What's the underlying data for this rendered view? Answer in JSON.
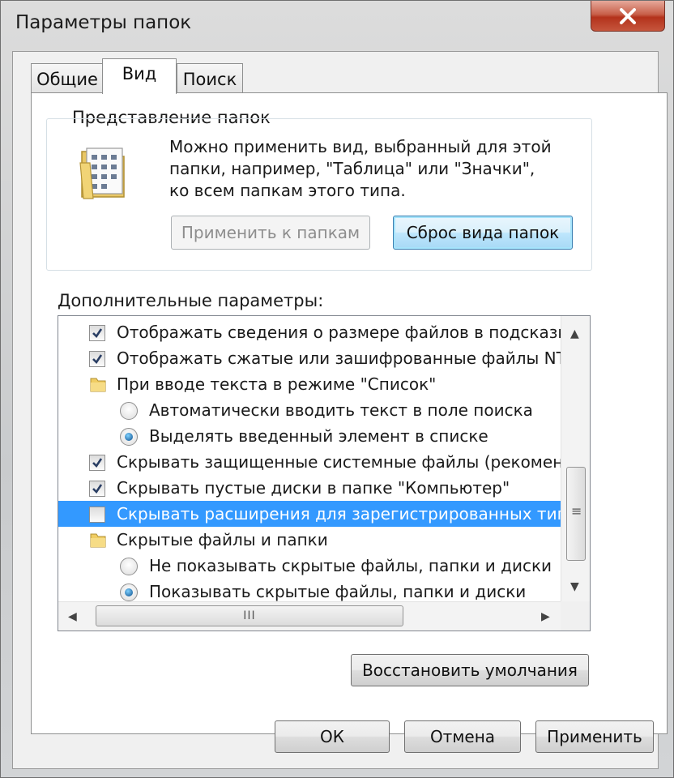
{
  "window": {
    "title": "Параметры папок"
  },
  "tabs": [
    {
      "label": "Общие"
    },
    {
      "label": "Вид"
    },
    {
      "label": "Поиск"
    }
  ],
  "folder_views": {
    "title": "Представление папок",
    "description": [
      "Можно применить вид, выбранный для этой",
      "папки, например, \"Таблица\" или \"Значки\",",
      "ко всем папкам этого типа."
    ],
    "apply_button": "Применить к папкам",
    "reset_button": "Сброс вида папок"
  },
  "advanced": {
    "label": "Дополнительные параметры:",
    "items": [
      {
        "type": "checkbox",
        "checked": true,
        "label": "Отображать сведения о размере файлов в подсказках"
      },
      {
        "type": "checkbox",
        "checked": true,
        "label": "Отображать сжатые или зашифрованные файлы NTFS"
      },
      {
        "type": "folder",
        "label": "При вводе текста в режиме \"Список\""
      },
      {
        "type": "radio",
        "checked": false,
        "label": "Автоматически вводить текст в поле поиска"
      },
      {
        "type": "radio",
        "checked": true,
        "label": "Выделять введенный элемент в списке"
      },
      {
        "type": "checkbox",
        "checked": true,
        "label": "Скрывать защищенные системные файлы (рекомендуется)"
      },
      {
        "type": "checkbox",
        "checked": true,
        "label": "Скрывать пустые диски в папке \"Компьютер\""
      },
      {
        "type": "checkbox",
        "checked": false,
        "selected": true,
        "label": "Скрывать расширения для зарегистрированных типов файлов"
      },
      {
        "type": "folder",
        "label": "Скрытые файлы и папки"
      },
      {
        "type": "radio",
        "checked": false,
        "label": "Не показывать скрытые файлы, папки и диски"
      },
      {
        "type": "radio",
        "checked": true,
        "label": "Показывать скрытые файлы, папки и диски"
      }
    ],
    "hscroll_grip": "III",
    "vscroll_grip": "≡"
  },
  "restore_button": "Восстановить умолчания",
  "footer": {
    "ok": "ОК",
    "cancel": "Отмена",
    "apply": "Применить"
  },
  "colors": {
    "selection": "#3399ff",
    "close_button": "#c8604a"
  }
}
